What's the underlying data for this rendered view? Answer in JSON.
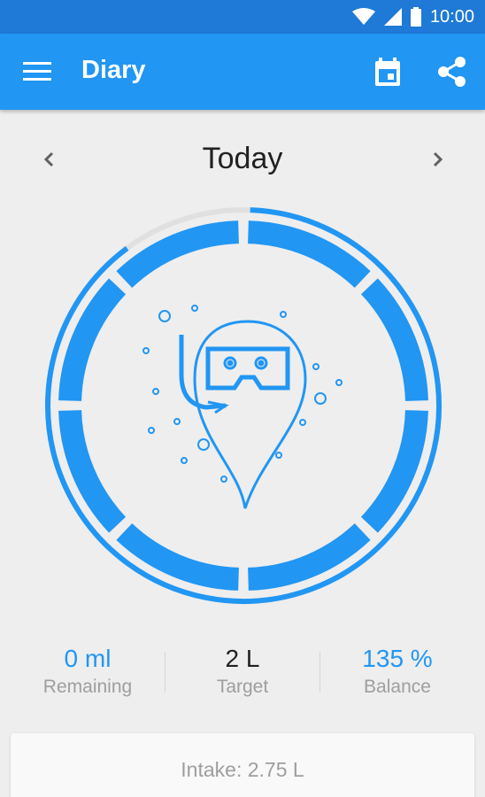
{
  "status_bar": {
    "time": "10:00"
  },
  "app_bar": {
    "title": "Diary",
    "calendar_icon": "calendar-icon",
    "share_icon": "share-icon",
    "menu_icon": "menu-icon"
  },
  "date_nav": {
    "title": "Today"
  },
  "progress": {
    "fill_fraction": 0.92,
    "segments": 8,
    "accent": "#2196f3",
    "track": "#e0e0e0"
  },
  "stats": {
    "remaining_value": "0 ml",
    "remaining_label": "Remaining",
    "target_value": "2 L",
    "target_label": "Target",
    "balance_value": "135 %",
    "balance_label": "Balance"
  },
  "intake": {
    "text": "Intake: 2.75 L"
  },
  "colors": {
    "primary": "#2196f3",
    "primary_dark": "#1e7ad6",
    "accent_text": "#2196f3"
  }
}
